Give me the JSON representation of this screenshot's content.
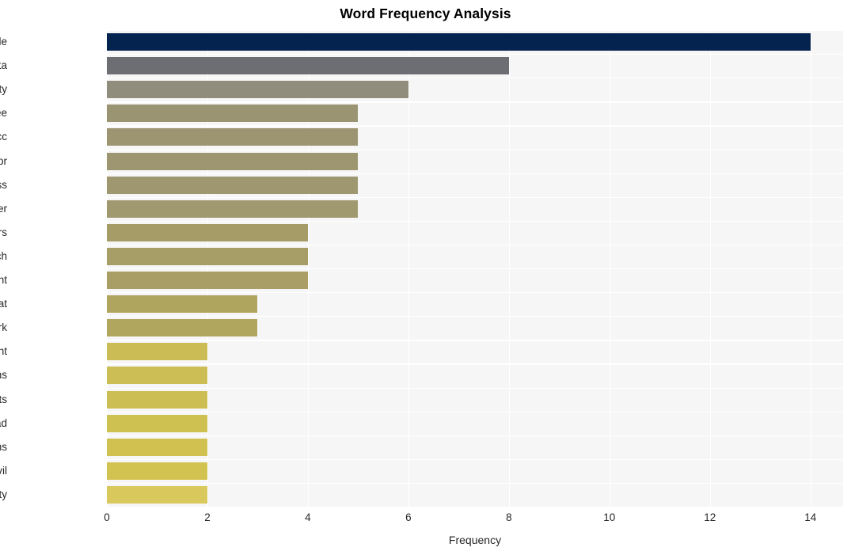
{
  "chart_data": {
    "type": "bar",
    "orientation": "horizontal",
    "title": "Word Frequency Analysis",
    "xlabel": "Frequency",
    "ylabel": "",
    "categories": [
      "mobile",
      "data",
      "cybersecurity",
      "agree",
      "fcc",
      "actor",
      "access",
      "customer",
      "customers",
      "breach",
      "account",
      "threat",
      "network",
      "settlement",
      "communications",
      "incidents",
      "lead",
      "millions",
      "civil",
      "penalty"
    ],
    "values": [
      14,
      8,
      6,
      5,
      5,
      5,
      5,
      5,
      4,
      4,
      4,
      3,
      3,
      2,
      2,
      2,
      2,
      2,
      2,
      2
    ],
    "bar_colors": [
      "#04244f",
      "#6c6e73",
      "#918d7d",
      "#9b9473",
      "#9d9571",
      "#9e9670",
      "#9f976f",
      "#a0986e",
      "#a69c68",
      "#a79d67",
      "#a89e66",
      "#b0a55f",
      "#b1a65e",
      "#cbbc55",
      "#ccbd54",
      "#cdbe53",
      "#cfc052",
      "#d0c151",
      "#d2c350",
      "#d9c85c"
    ],
    "xlim": [
      0,
      14.65
    ],
    "xticks": [
      0,
      2,
      4,
      6,
      8,
      10,
      12,
      14
    ],
    "xtick_labels": [
      "0",
      "2",
      "4",
      "6",
      "8",
      "10",
      "12",
      "14"
    ],
    "grid": true,
    "grid_color": "#ffffff",
    "plot_background": "#f6f6f6",
    "figure_background": "#ffffff",
    "legend": null
  }
}
